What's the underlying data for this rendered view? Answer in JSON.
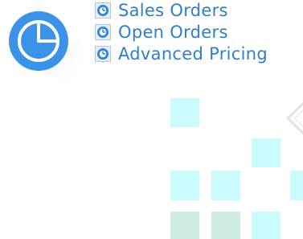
{
  "app": {
    "icon": "pie-chart-icon",
    "icon_colors": {
      "circle": "#3a93e8",
      "ring": "#ffffff",
      "shadow": "#d4dde6"
    }
  },
  "menu": {
    "items": [
      {
        "label": "Sales Orders",
        "icon": "clock-icon"
      },
      {
        "label": "Open Orders",
        "icon": "clock-icon"
      },
      {
        "label": "Advanced Pricing",
        "icon": "clock-icon"
      }
    ],
    "label_color": "#2e7fc8"
  },
  "decoration": {
    "tile_color": "#ccfbfd",
    "tile_color_alt": "#cfece4"
  }
}
